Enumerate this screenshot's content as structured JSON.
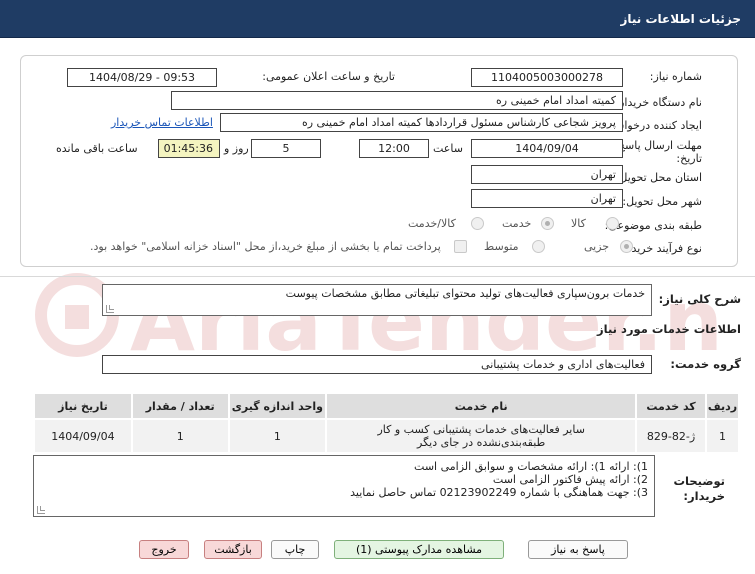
{
  "header": {
    "title": "جزئیات اطلاعات نیاز"
  },
  "watermark": {
    "text": "AriaTender.neT"
  },
  "form": {
    "need_number": {
      "label": "شماره نیاز:",
      "value": "1104005003000278"
    },
    "announce_datetime": {
      "label": "تاریخ و ساعت اعلان عمومی:",
      "value": "1404/08/29 - 09:53"
    },
    "buyer_org": {
      "label": "نام دستگاه خریدار:",
      "value": "کمیته امداد امام خمینی ره"
    },
    "requester": {
      "label": "ایجاد کننده درخواست:",
      "value": "پرویز شجاعی کارشناس مسئول قراردادها کمیته امداد امام خمینی ره",
      "contact_link": "اطلاعات تماس خریدار"
    },
    "deadline": {
      "label_line1": "مهلت ارسال پاسخ: تا",
      "label_line2": "تاریخ:",
      "date": "1404/09/04",
      "time_label": "ساعت",
      "time": "12:00",
      "days": "5",
      "days_label": "روز و",
      "remaining": "01:45:36",
      "remaining_label": "ساعت باقی مانده"
    },
    "province": {
      "label": "استان محل تحویل:",
      "value": "تهران"
    },
    "city": {
      "label": "شهر محل تحویل:",
      "value": "تهران"
    },
    "category": {
      "label": "طبقه بندی موضوعی:",
      "options": [
        "کالا",
        "خدمت",
        "کالا/خدمت"
      ],
      "selected": "خدمت"
    },
    "purchase_type": {
      "label": "نوع فرآیند خرید :",
      "options": [
        "جزیی",
        "متوسط"
      ],
      "selected": "جزیی",
      "payment_note": "پرداخت تمام یا بخشی از مبلغ خرید،از محل \"اسناد خزانه اسلامی\" خواهد بود."
    }
  },
  "summary": {
    "label": "شرح کلی نیاز:",
    "value": "خدمات برون‌سپاری فعالیت‌های تولید محتوای تبلیغاتی مطابق مشخصات پیوست"
  },
  "services_section": {
    "title": "اطلاعات خدمات مورد نیاز",
    "group_label": "گروه خدمت:",
    "group_value": "فعالیت‌های اداری و خدمات پشتیبانی"
  },
  "table": {
    "headers": [
      "ردیف",
      "کد خدمت",
      "نام خدمت",
      "واحد اندازه گیری",
      "تعداد / مقدار",
      "تاریخ نیاز"
    ],
    "rows": [
      {
        "row": "1",
        "code": "ژ-82-829",
        "name_line1": "سایر فعالیت‌های خدمات پشتیبانی کسب و کار",
        "name_line2": "طبقه‌بندی‌نشده در جای دیگر",
        "unit": "1",
        "qty": "1",
        "date": "1404/09/04"
      }
    ]
  },
  "buyer_notes": {
    "label_line1": "توضیحات",
    "label_line2": "خریدار:",
    "lines": [
      "1): ارائه 1): ارائه مشخصات و سوابق الزامی است",
      "2): ارائه پیش فاکتور الزامی است",
      "3): جهت هماهنگی با شماره 02123902249 تماس حاصل نمایید"
    ]
  },
  "buttons": {
    "reply": "پاسخ به نیاز",
    "view_docs": "مشاهده مدارک پیوستی (1)",
    "print": "چاپ",
    "back": "بازگشت",
    "exit": "خروج"
  },
  "colors": {
    "header_bg": "#1f3c64",
    "remaining_bg": "#f4f4c0",
    "link": "#1a55b8",
    "watermark": "#e8b8b8"
  }
}
